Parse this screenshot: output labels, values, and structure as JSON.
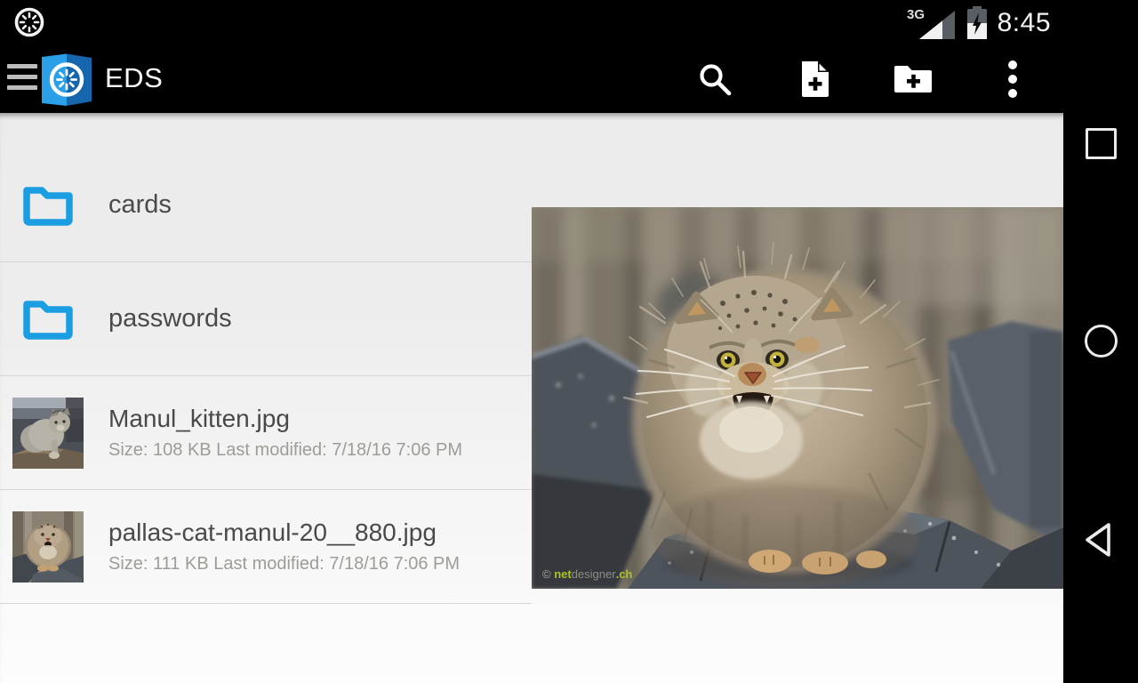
{
  "status_bar": {
    "time": "8:45",
    "network": "3G"
  },
  "app_bar": {
    "title": "EDS"
  },
  "file_list": {
    "items": [
      {
        "type": "folder",
        "name": "cards"
      },
      {
        "type": "folder",
        "name": "passwords"
      },
      {
        "type": "file",
        "name": "Manul_kitten.jpg",
        "details": "Size: 108 KB Last modified: 7/18/16 7:06 PM"
      },
      {
        "type": "file",
        "name": "pallas-cat-manul-20__880.jpg",
        "details": "Size: 111 KB Last modified: 7/18/16 7:06 PM"
      }
    ]
  },
  "preview": {
    "watermark": {
      "copyright": "© ",
      "part1": "net",
      "part2": "designer",
      "part3": ".ch"
    }
  },
  "colors": {
    "accent_blue": "#1b9de2",
    "app_bar_bg": "#000000",
    "content_bg": "#ededed",
    "divider": "#d6d6d4",
    "title_text": "#494947",
    "subtitle_text": "#9d9d97",
    "watermark_green": "#a8c525"
  }
}
